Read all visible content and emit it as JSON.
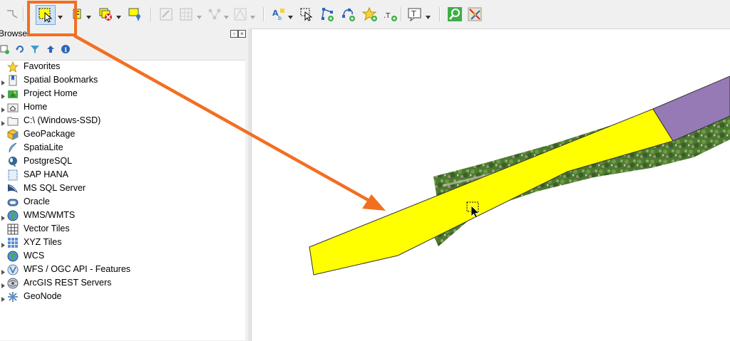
{
  "browser": {
    "title": "Browser",
    "items": [
      {
        "label": "Favorites",
        "icon": "star-icon",
        "expandable": false
      },
      {
        "label": "Spatial Bookmarks",
        "icon": "bookmark-icon",
        "expandable": true
      },
      {
        "label": "Project Home",
        "icon": "project-home-icon",
        "expandable": true
      },
      {
        "label": "Home",
        "icon": "home-folder-icon",
        "expandable": true
      },
      {
        "label": "C:\\ (Windows-SSD)",
        "icon": "drive-folder-icon",
        "expandable": true
      },
      {
        "label": "GeoPackage",
        "icon": "geopackage-icon",
        "expandable": false
      },
      {
        "label": "SpatiaLite",
        "icon": "spatialite-icon",
        "expandable": false
      },
      {
        "label": "PostgreSQL",
        "icon": "postgresql-icon",
        "expandable": false
      },
      {
        "label": "SAP HANA",
        "icon": "sap-hana-icon",
        "expandable": false
      },
      {
        "label": "MS SQL Server",
        "icon": "mssql-icon",
        "expandable": false
      },
      {
        "label": "Oracle",
        "icon": "oracle-icon",
        "expandable": false
      },
      {
        "label": "WMS/WMTS",
        "icon": "globe-icon",
        "expandable": true
      },
      {
        "label": "Vector Tiles",
        "icon": "vector-tiles-icon",
        "expandable": false
      },
      {
        "label": "XYZ Tiles",
        "icon": "xyz-tiles-icon",
        "expandable": true
      },
      {
        "label": "WCS",
        "icon": "globe-icon",
        "expandable": false
      },
      {
        "label": "WFS / OGC API - Features",
        "icon": "wfs-icon",
        "expandable": true
      },
      {
        "label": "ArcGIS REST Servers",
        "icon": "arcgis-icon",
        "expandable": true
      },
      {
        "label": "GeoNode",
        "icon": "geonode-icon",
        "expandable": true
      }
    ]
  },
  "colors": {
    "highlight_annotation": "#f26f21",
    "selected_polygon": "#ffff00",
    "neighbor_polygon": "#967ab6",
    "imagery_green": "#4c7a30"
  }
}
